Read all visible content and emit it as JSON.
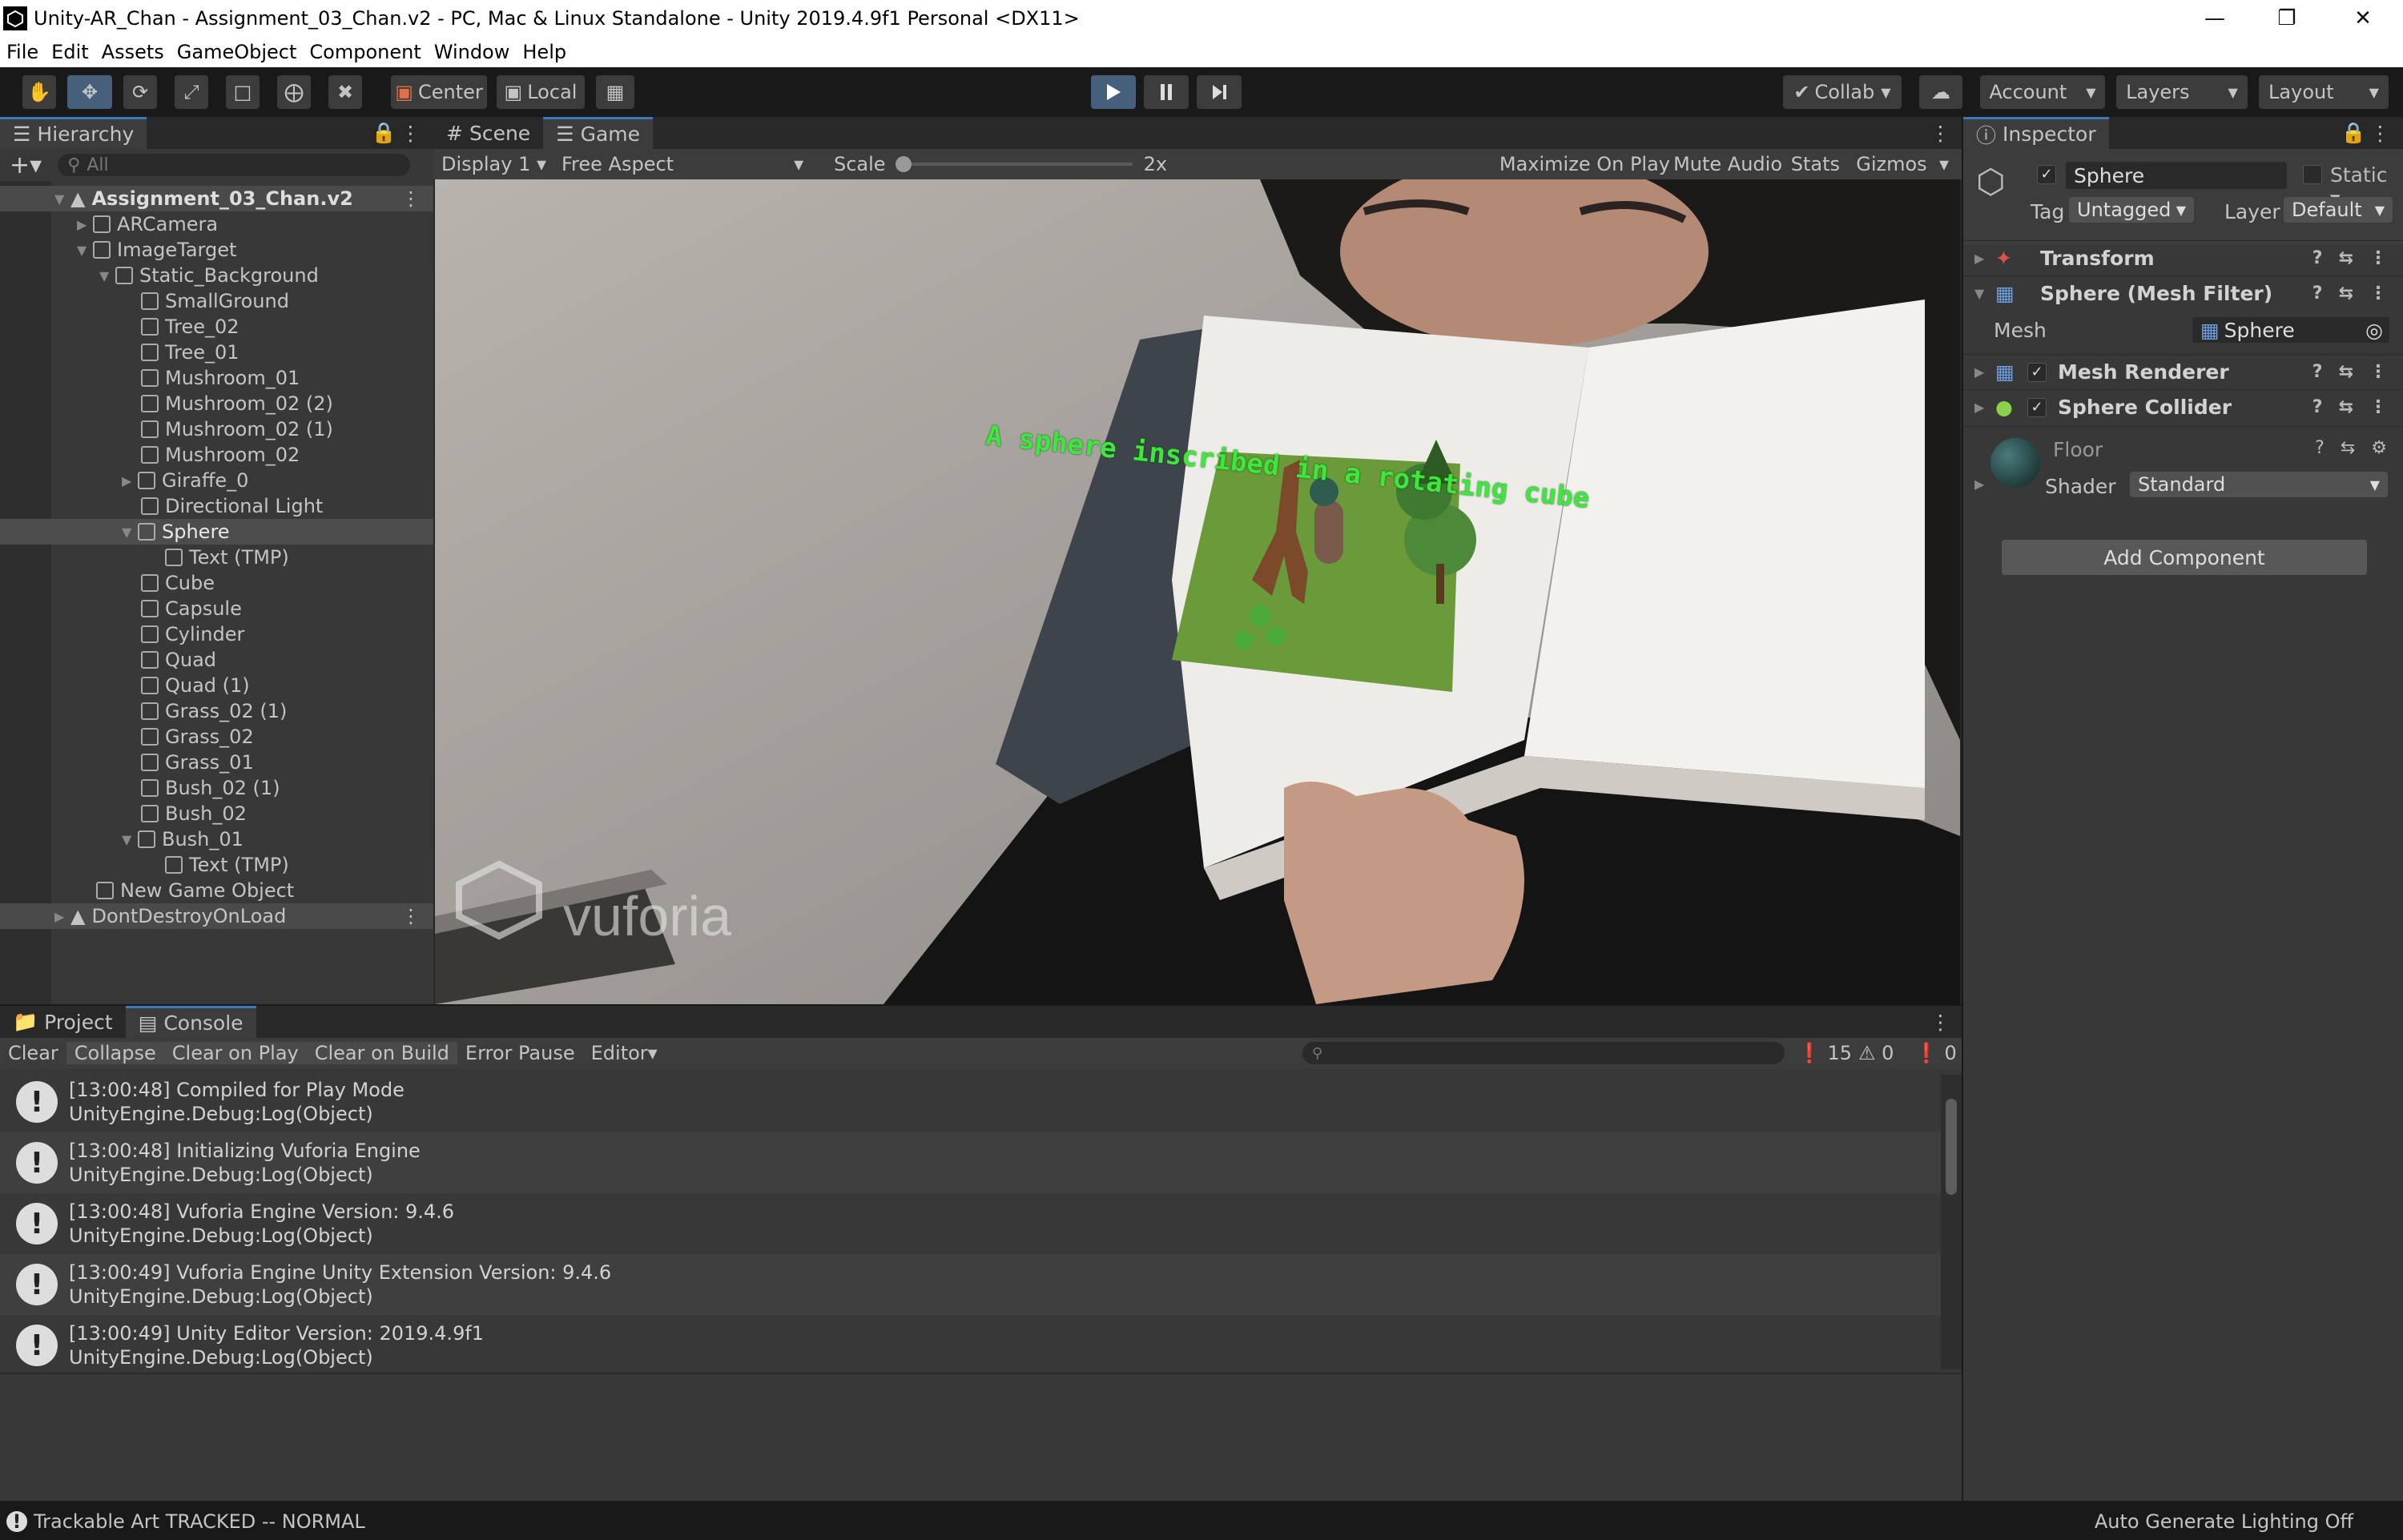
{
  "window": {
    "title": "Unity-AR_Chan - Assignment_03_Chan.v2 - PC, Mac & Linux Standalone - Unity 2019.4.9f1 Personal <DX11>"
  },
  "menu": [
    "File",
    "Edit",
    "Assets",
    "GameObject",
    "Component",
    "Window",
    "Help"
  ],
  "toolbar": {
    "center_label": "Center",
    "local_label": "Local",
    "collab_label": "Collab",
    "account_label": "Account",
    "layers_label": "Layers",
    "layout_label": "Layout"
  },
  "hierarchy": {
    "tab": "Hierarchy",
    "search_placeholder": "All",
    "scene": "Assignment_03_Chan.v2",
    "items": [
      "ARCamera",
      "ImageTarget",
      "Static_Background",
      "SmallGround",
      "Tree_02",
      "Tree_01",
      "Mushroom_01",
      "Mushroom_02 (2)",
      "Mushroom_02 (1)",
      "Mushroom_02",
      "Giraffe_0",
      "Directional Light",
      "Sphere",
      "Text (TMP)",
      "Cube",
      "Capsule",
      "Cylinder",
      "Quad",
      "Quad (1)",
      "Grass_02 (1)",
      "Grass_02",
      "Grass_01",
      "Bush_02 (1)",
      "Bush_02",
      "Bush_01",
      "Text (TMP)",
      "New Game Object"
    ],
    "ddol": "DontDestroyOnLoad"
  },
  "game": {
    "tab_scene": "Scene",
    "tab_game": "Game",
    "display": "Display 1",
    "aspect": "Free Aspect",
    "scale_label": "Scale",
    "scale_value": "2x",
    "maximize": "Maximize On Play",
    "mute": "Mute Audio",
    "stats": "Stats",
    "gizmos": "Gizmos",
    "ar_text": "A sphere inscribed in a rotating cube",
    "watermark": "vuforia"
  },
  "inspector": {
    "tab": "Inspector",
    "object_name": "Sphere",
    "static_label": "Static",
    "tag_label": "Tag",
    "tag_value": "Untagged",
    "layer_label": "Layer",
    "layer_value": "Default",
    "components": [
      "Transform",
      "Sphere (Mesh Filter)",
      "Mesh Renderer",
      "Sphere Collider"
    ],
    "mesh_label": "Mesh",
    "mesh_value": "Sphere",
    "material_name": "Floor",
    "shader_label": "Shader",
    "shader_value": "Standard",
    "add_component": "Add Component"
  },
  "console": {
    "tab_project": "Project",
    "tab_console": "Console",
    "buttons": [
      "Clear",
      "Collapse",
      "Clear on Play",
      "Clear on Build",
      "Error Pause",
      "Editor"
    ],
    "count_log": "15",
    "count_warn": "0",
    "count_err": "0",
    "entries": [
      {
        "line1": "[13:00:48] Compiled for Play Mode",
        "line2": "UnityEngine.Debug:Log(Object)"
      },
      {
        "line1": "[13:00:48] Initializing Vuforia Engine",
        "line2": "UnityEngine.Debug:Log(Object)"
      },
      {
        "line1": "[13:00:48] Vuforia Engine Version: 9.4.6",
        "line2": "UnityEngine.Debug:Log(Object)"
      },
      {
        "line1": "[13:00:49] Vuforia Engine Unity Extension Version: 9.4.6",
        "line2": "UnityEngine.Debug:Log(Object)"
      },
      {
        "line1": "[13:00:49] Unity Editor Version: 2019.4.9f1",
        "line2": "UnityEngine.Debug:Log(Object)"
      }
    ]
  },
  "status": {
    "left": "Trackable Art TRACKED -- NORMAL",
    "right": "Auto Generate Lighting Off"
  },
  "colors": {
    "accent": "#3a79bb",
    "panel": "#383838",
    "dark": "#191919",
    "grass": "#6a9a3a"
  }
}
